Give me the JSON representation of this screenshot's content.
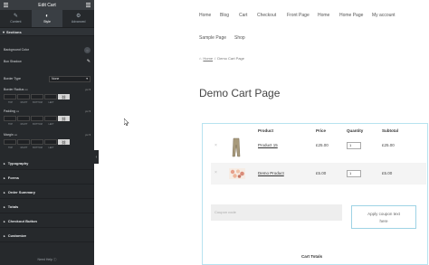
{
  "panel": {
    "title": "Edit Cart",
    "tabs": [
      {
        "label": "Content",
        "icon": "pencil-icon"
      },
      {
        "label": "Style",
        "icon": "half-circle-icon"
      },
      {
        "label": "Advanced",
        "icon": "gear-icon"
      }
    ],
    "active_tab": "Style",
    "section_title": "Sections",
    "background_color_label": "Background Color",
    "box_shadow_label": "Box Shadow",
    "border_type_label": "Border Type",
    "border_type_value": "None",
    "border_radius_label": "Border Radius",
    "padding_label": "Padding",
    "margin_label": "Margin",
    "unit_label": "px",
    "dimension_labels": [
      "TOP",
      "RIGHT",
      "BOTTOM",
      "LEFT"
    ],
    "collapsed_sections": [
      "Typography",
      "Forms",
      "Order Summary",
      "Totals",
      "Checkout Button",
      "Customize"
    ],
    "need_help": "Need Help"
  },
  "site": {
    "nav": [
      "Home",
      "Blog",
      "Cart",
      "Checkout",
      "Front Page",
      "Home",
      "Home Page",
      "My account",
      "Sample Page",
      "Shop"
    ],
    "breadcrumb_home": "Home",
    "breadcrumb_sep": "/",
    "breadcrumb_current": "Demo Cart Page",
    "page_title": "Demo Cart Page"
  },
  "cart": {
    "headers": {
      "product": "Product",
      "price": "Price",
      "quantity": "Quantity",
      "subtotal": "Subtotal"
    },
    "rows": [
      {
        "product": "Product 15",
        "price": "£25.00",
        "qty": "1",
        "subtotal": "£25.00",
        "thumb": "trousers"
      },
      {
        "product": "Demo Product",
        "price": "£5.00",
        "qty": "1",
        "subtotal": "£5.00",
        "thumb": "flowers"
      }
    ],
    "coupon_placeholder": "Coupon code",
    "apply_label_1": "Apply coupon text",
    "apply_label_2": "here",
    "totals_title": "Cart Totals"
  },
  "colors": {
    "panel_bg": "#26292c",
    "frame_border": "#b7e3f0",
    "accent": "#9ed3e5"
  }
}
